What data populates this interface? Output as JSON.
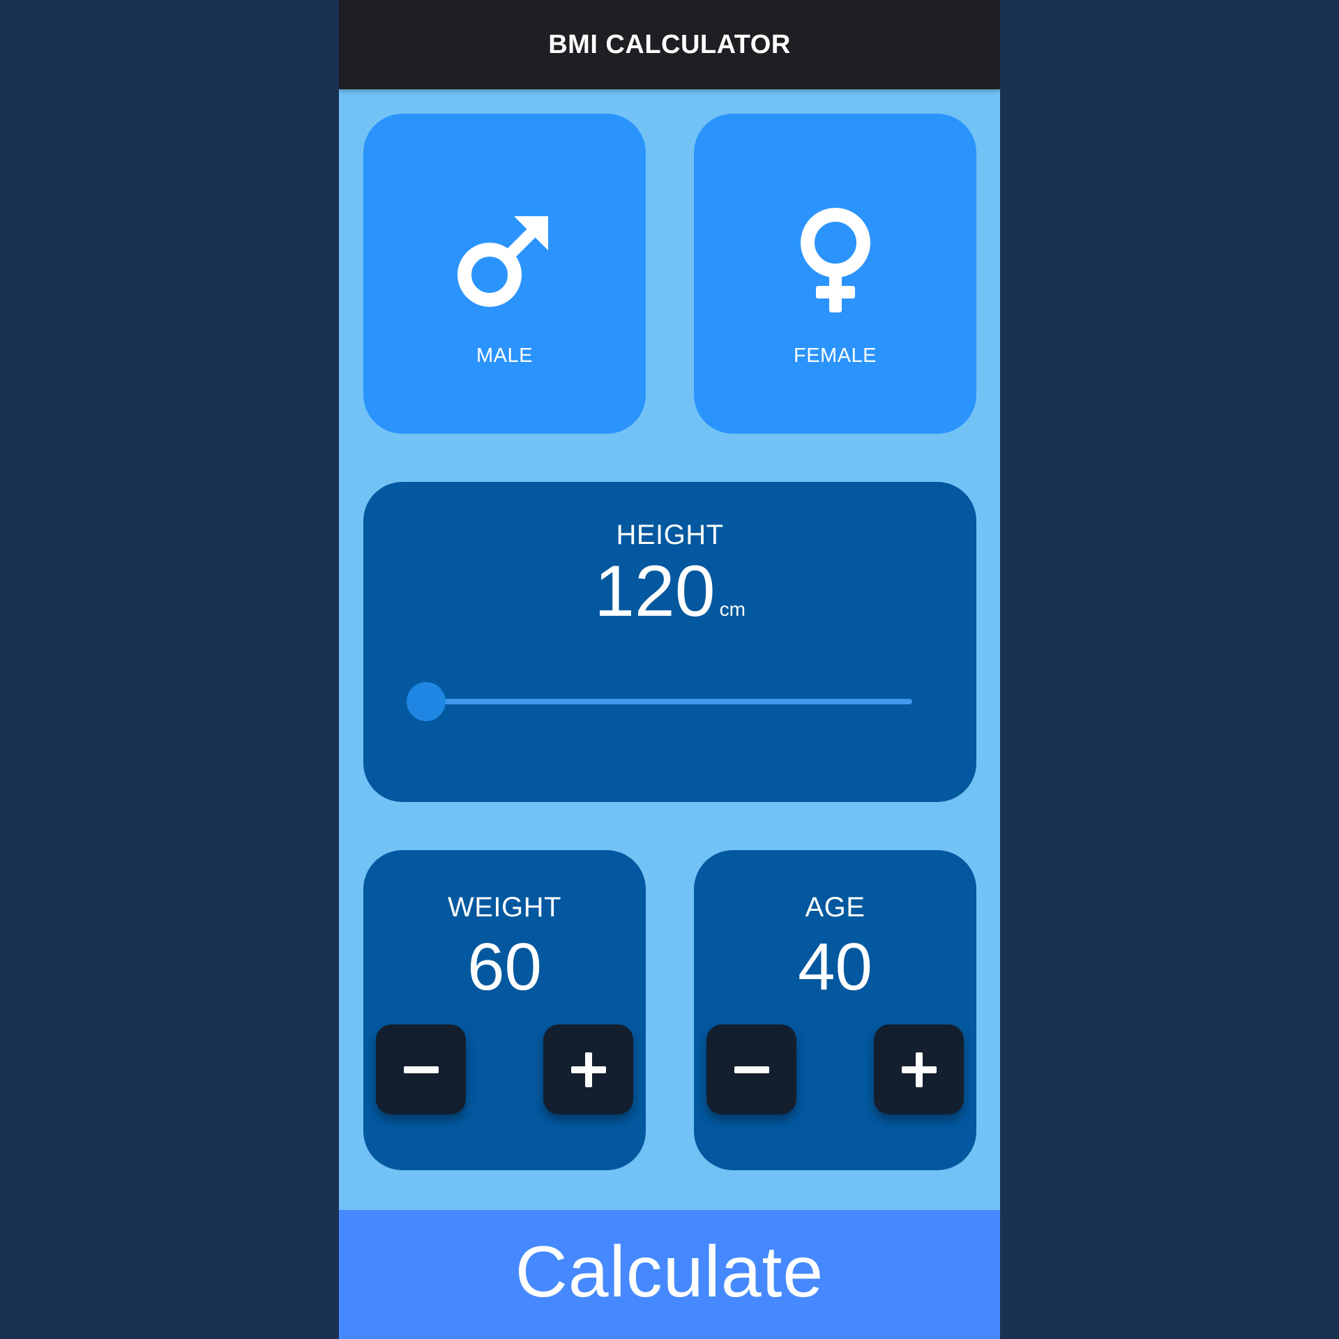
{
  "app": {
    "title": "BMI CALCULATOR"
  },
  "gender": {
    "male": {
      "label": "MALE",
      "icon": "male-symbol-icon"
    },
    "female": {
      "label": "FEMALE",
      "icon": "female-symbol-icon"
    }
  },
  "height": {
    "label": "HEIGHT",
    "value": "120",
    "unit": "cm",
    "slider_fraction": 0
  },
  "weight": {
    "label": "WEIGHT",
    "value": "60",
    "decrement_icon": "minus-icon",
    "increment_icon": "plus-icon"
  },
  "age": {
    "label": "AGE",
    "value": "40",
    "decrement_icon": "minus-icon",
    "increment_icon": "plus-icon"
  },
  "calculate": {
    "label": "Calculate"
  },
  "colors": {
    "page_background": "#1b3152",
    "screen_background": "#72c2f6",
    "appbar": "#1e1f22",
    "gender_card": "#2b94fc",
    "input_card": "#03589f",
    "step_button": "#131f2f",
    "slider_track": "#3f98ee",
    "slider_thumb": "#1f87e3",
    "calculate_button": "#4689fe"
  }
}
